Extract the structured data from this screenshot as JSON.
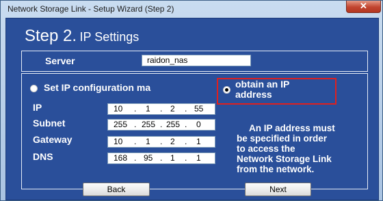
{
  "window": {
    "title": "Network Storage Link - Setup Wizard (Step 2)",
    "close_label": "✕"
  },
  "header": {
    "step": "Step 2.",
    "subtitle": "IP Settings"
  },
  "server": {
    "label": "Server",
    "value": "raidon_nas"
  },
  "ip_config": {
    "manual_label": "Set IP configuration ma",
    "obtain_label_line1": "obtain an IP",
    "obtain_label_line2": "address",
    "selected_option": "obtain",
    "fields": [
      {
        "label": "IP",
        "octets": [
          "10",
          "1",
          "2",
          "55"
        ]
      },
      {
        "label": "Subnet",
        "octets": [
          "255",
          "255",
          "255",
          "0"
        ]
      },
      {
        "label": "Gateway",
        "octets": [
          "10",
          "1",
          "2",
          "1"
        ]
      },
      {
        "label": "DNS",
        "octets": [
          "168",
          "95",
          "1",
          "1"
        ]
      }
    ],
    "info_lines": [
      "An IP address must",
      "be specified in order",
      "to access the",
      "Network Storage Link",
      "from the network."
    ]
  },
  "buttons": {
    "back": "Back",
    "next": "Next"
  },
  "colors": {
    "client_bg": "#2a4f9a",
    "highlight": "#e0201e"
  }
}
